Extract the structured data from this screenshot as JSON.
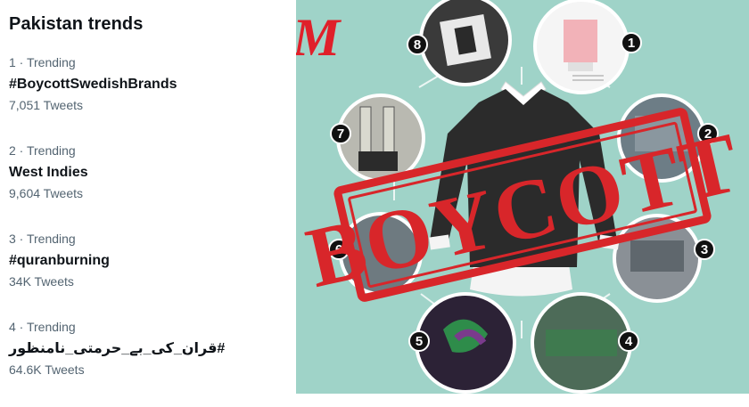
{
  "trends_panel": {
    "title": "Pakistan trends",
    "items": [
      {
        "meta": "1 · Trending",
        "name": "#BoycottSwedishBrands",
        "count": "7,051 Tweets"
      },
      {
        "meta": "2 · Trending",
        "name": "West Indies",
        "count": "9,604 Tweets"
      },
      {
        "meta": "3 · Trending",
        "name": "#quranburning",
        "count": "34K Tweets"
      },
      {
        "meta": "4 · Trending",
        "name": "#قران_کی_بے_حرمتی_نامنظور",
        "count": "64.6K Tweets"
      }
    ]
  },
  "image": {
    "brand_fragment": "M",
    "stamp_text": "BOYCOTT",
    "step_numbers": [
      "1",
      "2",
      "3",
      "4",
      "5",
      "6",
      "7",
      "8"
    ],
    "colors": {
      "background": "#9fd3c8",
      "stamp_red": "#d8262a",
      "brand_red": "#e0202a",
      "sweater": "#2b2b2b"
    }
  }
}
